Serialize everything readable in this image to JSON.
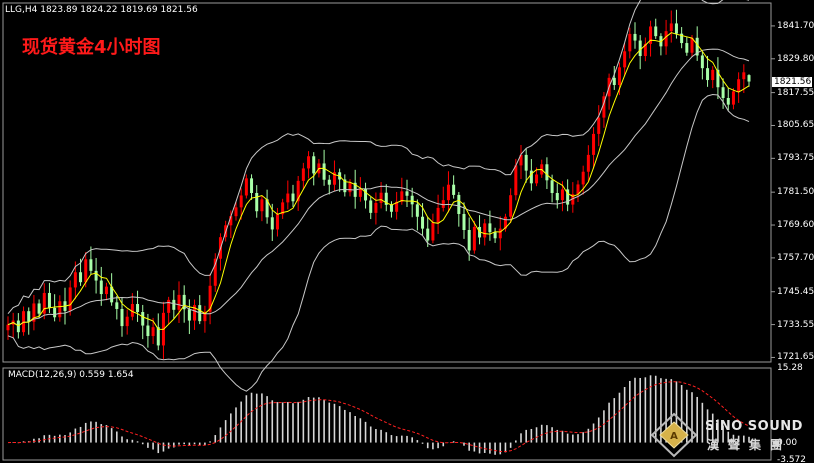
{
  "header": {
    "ohlc": "LLG,H4  1823.89 1824.22 1819.69 1821.56",
    "title": "现货黄金4小时图"
  },
  "macd_label": "MACD(12,26,9) 0.559 1.654",
  "watermark": {
    "name": "SiNO SOUND",
    "cn": "漢聲集團"
  },
  "colors": {
    "up": "#ff0000",
    "down": "#a8ffa8",
    "ma": "#ffff00",
    "band": "#c8c8c8",
    "signal": "#ff2020",
    "hist": "#d8d8d8",
    "bg": "#000000",
    "title": "#ff1a1a"
  },
  "chart_data": [
    {
      "type": "candlestick",
      "title": "现货黄金4小时图",
      "symbol": "LLG",
      "timeframe": "H4",
      "last_bar": {
        "open": 1823.89,
        "high": 1824.22,
        "low": 1819.69,
        "close": 1821.56
      },
      "current_price_label": "1821.56",
      "ylim": [
        1720.0,
        1850.0
      ],
      "y_ticks": [
        "1841.70",
        "1829.80",
        "1817.55",
        "1805.65",
        "1793.75",
        "1781.50",
        "1769.60",
        "1757.70",
        "1745.45",
        "1733.55",
        "1721.65"
      ],
      "y_tick_values": [
        1841.7,
        1829.8,
        1817.55,
        1805.65,
        1793.75,
        1781.5,
        1769.6,
        1757.7,
        1745.45,
        1733.55,
        1721.65
      ],
      "indicators": [
        "Bollinger Bands",
        "Moving Average"
      ],
      "close": [
        1733.5,
        1735.0,
        1730.8,
        1738.4,
        1734.6,
        1741.2,
        1737.5,
        1745.0,
        1739.6,
        1736.2,
        1742.0,
        1738.5,
        1747.0,
        1752.5,
        1748.9,
        1757.2,
        1753.0,
        1749.5,
        1744.6,
        1747.3,
        1741.6,
        1739.2,
        1733.0,
        1736.4,
        1741.0,
        1738.1,
        1733.2,
        1729.4,
        1732.6,
        1726.0,
        1737.8,
        1742.5,
        1738.9,
        1744.3,
        1739.1,
        1735.0,
        1740.6,
        1734.8,
        1738.2,
        1747.6,
        1757.4,
        1765.2,
        1769.5,
        1772.8,
        1776.0,
        1780.3,
        1786.5,
        1781.2,
        1774.6,
        1778.9,
        1772.4,
        1768.0,
        1773.5,
        1777.8,
        1781.0,
        1778.2,
        1785.6,
        1790.1,
        1794.5,
        1788.3,
        1791.9,
        1786.0,
        1784.2,
        1788.7,
        1786.1,
        1781.5,
        1784.9,
        1779.8,
        1782.7,
        1778.5,
        1774.0,
        1777.6,
        1781.3,
        1776.9,
        1774.4,
        1778.0,
        1781.8,
        1780.2,
        1777.1,
        1772.6,
        1768.3,
        1764.0,
        1770.5,
        1775.8,
        1778.6,
        1784.2,
        1780.5,
        1773.6,
        1767.8,
        1760.4,
        1768.9,
        1765.1,
        1770.2,
        1767.0,
        1764.8,
        1768.3,
        1772.6,
        1780.4,
        1791.2,
        1795.0,
        1789.3,
        1784.7,
        1787.9,
        1791.6,
        1785.8,
        1781.2,
        1778.6,
        1782.5,
        1777.0,
        1780.8,
        1784.3,
        1788.9,
        1795.0,
        1802.6,
        1808.5,
        1816.2,
        1822.9,
        1820.3,
        1826.7,
        1832.5,
        1838.8,
        1836.4,
        1830.8,
        1835.2,
        1841.5,
        1838.0,
        1834.3,
        1839.8,
        1842.6,
        1838.9,
        1835.5,
        1832.0,
        1837.4,
        1831.0,
        1826.4,
        1822.1,
        1825.8,
        1819.5,
        1815.6,
        1813.2,
        1818.0,
        1822.4,
        1824.9,
        1821.56
      ],
      "x_count": 146
    },
    {
      "type": "bar",
      "title": "MACD(12,26,9)",
      "series": [
        {
          "name": "MACD",
          "value": 0.559
        },
        {
          "name": "Signal",
          "value": 1.654
        }
      ],
      "y_ticks": [
        "15.28",
        "0.00",
        "-3.572"
      ],
      "y_tick_values": [
        15.28,
        0.0,
        -3.572
      ],
      "ylim": [
        -3.572,
        15.28
      ]
    }
  ]
}
